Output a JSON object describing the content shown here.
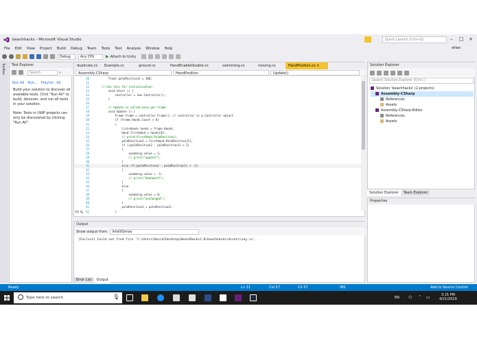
{
  "window": {
    "title": "beachhacks - Microsoft Visual Studio",
    "quick_launch_placeholder": "Quick Launch (Ctrl+Q)",
    "user": "wliao"
  },
  "menu": [
    "File",
    "Edit",
    "View",
    "Project",
    "Build",
    "Debug",
    "Team",
    "Tools",
    "Test",
    "Analyze",
    "Window",
    "Help"
  ],
  "toolbar": {
    "config": "Debug",
    "platform": "Any CPU",
    "attach": "Attach to Unity"
  },
  "left_strip": {
    "label": "Toolbox"
  },
  "test_explorer": {
    "title": "Test Explorer",
    "search_placeholder": "Search",
    "run_all": "Run All",
    "run": "Run...",
    "playlist": "Playlist : All",
    "message1": "Build your solution to discover all available tests. Click \"Run All\" to build, discover, and run all tests in your solution.",
    "message2": "Note: Tests in UWP projects can only be discovered by clicking \"Run All\"."
  },
  "editor": {
    "tabs": [
      {
        "label": "duplicate.cs",
        "active": false
      },
      {
        "label": "Example.cs",
        "active": false
      },
      {
        "label": "ground.cs",
        "active": false
      },
      {
        "label": "HandEnableDisable.cs",
        "active": false
      },
      {
        "label": "swimming.cs",
        "active": false
      },
      {
        "label": "moving.cs",
        "active": false
      },
      {
        "label": "HandPosition.cs",
        "active": true
      }
    ],
    "nav_project": "Assembly-CSharp",
    "nav_class": "HandPosition",
    "nav_member": "Update()",
    "zoom": "77 %",
    "lines": [
      {
        "n": "10",
        "text": "        float palmPosition2 = 200;"
      },
      {
        "n": "11",
        "text": ""
      },
      {
        "n": "12",
        "text": "    // Use this for initialization"
      },
      {
        "n": "13",
        "text": "        void Start () {"
      },
      {
        "n": "14",
        "text": "            controller = new Controller();"
      },
      {
        "n": "15",
        "text": "        }"
      },
      {
        "n": "16",
        "text": ""
      },
      {
        "n": "17",
        "text": "        // Update is called once per frame"
      },
      {
        "n": "18",
        "text": "        void Update () {"
      },
      {
        "n": "19",
        "text": "            Frame frame = controller.Frame(); // controller is a Controller object"
      },
      {
        "n": "20",
        "text": "            if (frame.Hands.Count > 0)"
      },
      {
        "n": "21",
        "text": "            {"
      },
      {
        "n": "22",
        "text": "                List<Hand> hands = frame.Hands;"
      },
      {
        "n": "23",
        "text": "                Hand firstHand = hands[0];"
      },
      {
        "n": "24",
        "text": "                // print(firstHand.PalmPosition);"
      },
      {
        "n": "25",
        "text": "                palmPosition2 = firstHand.PalmPosition[1];"
      },
      {
        "n": "26",
        "text": "                if ((palmPosition2 - palmPosition1) > 2)"
      },
      {
        "n": "27",
        "text": "                {"
      },
      {
        "n": "28",
        "text": "                    swimming.value = 1;"
      },
      {
        "n": "29",
        "text": "                    // print(\"upward\");"
      },
      {
        "n": "30",
        "text": "                }"
      },
      {
        "n": "31",
        "text": "                else if((palmPosition2 - palmPosition1) < -2)"
      },
      {
        "n": "32",
        "text": "                {"
      },
      {
        "n": "33",
        "text": "                    swimming.value = -1;"
      },
      {
        "n": "34",
        "text": "                    // print(\"downward\");"
      },
      {
        "n": "35",
        "text": "                }"
      },
      {
        "n": "36",
        "text": "                else"
      },
      {
        "n": "37",
        "text": "                {"
      },
      {
        "n": "38",
        "text": "                    swimming.value = 0;"
      },
      {
        "n": "39",
        "text": "                    // print(\"unchanged\");"
      },
      {
        "n": "40",
        "text": "                }"
      },
      {
        "n": "41",
        "text": "                palmPosition1 = palmPosition2;"
      },
      {
        "n": "42",
        "text": "            }"
      }
    ]
  },
  "output": {
    "title": "Output",
    "show_from_label": "Show output from:",
    "show_from_value": "IntelliSense",
    "text": "[Failure] Could not find file 'C:\\Users\\David\\Desktop\\BeachHacks2.0\\beachhacks\\Assets\\sky.cs'.",
    "tabs": [
      "Error List",
      "Output"
    ]
  },
  "solution_explorer": {
    "title": "Solution Explorer",
    "search_placeholder": "Search Solution Explorer (Ctrl+;)",
    "tree": [
      {
        "label": "Solution 'beachhacks' (2 projects)",
        "indent": 0
      },
      {
        "label": "Assembly-CSharp",
        "indent": 1
      },
      {
        "label": "References",
        "indent": 2
      },
      {
        "label": "Assets",
        "indent": 2
      },
      {
        "label": "Assembly-CSharp-Editor",
        "indent": 1
      },
      {
        "label": "References",
        "indent": 2
      },
      {
        "label": "Assets",
        "indent": 2
      }
    ],
    "tabs": [
      "Solution Explorer",
      "Team Explorer"
    ]
  },
  "properties": {
    "title": "Properties"
  },
  "status": {
    "ready": "Ready",
    "ln": "Ln 31",
    "col": "Col 57",
    "ch": "Ch 57",
    "ins": "INS",
    "source_control": "Add to Source Control"
  },
  "taskbar": {
    "search_placeholder": "Type here to search",
    "lang": "EN",
    "time": "3:15 PM",
    "date": "4/21/2019"
  },
  "colors": {
    "accent": "#007acc",
    "active_tab": "#f4c430",
    "vs_purple": "#68217a"
  }
}
